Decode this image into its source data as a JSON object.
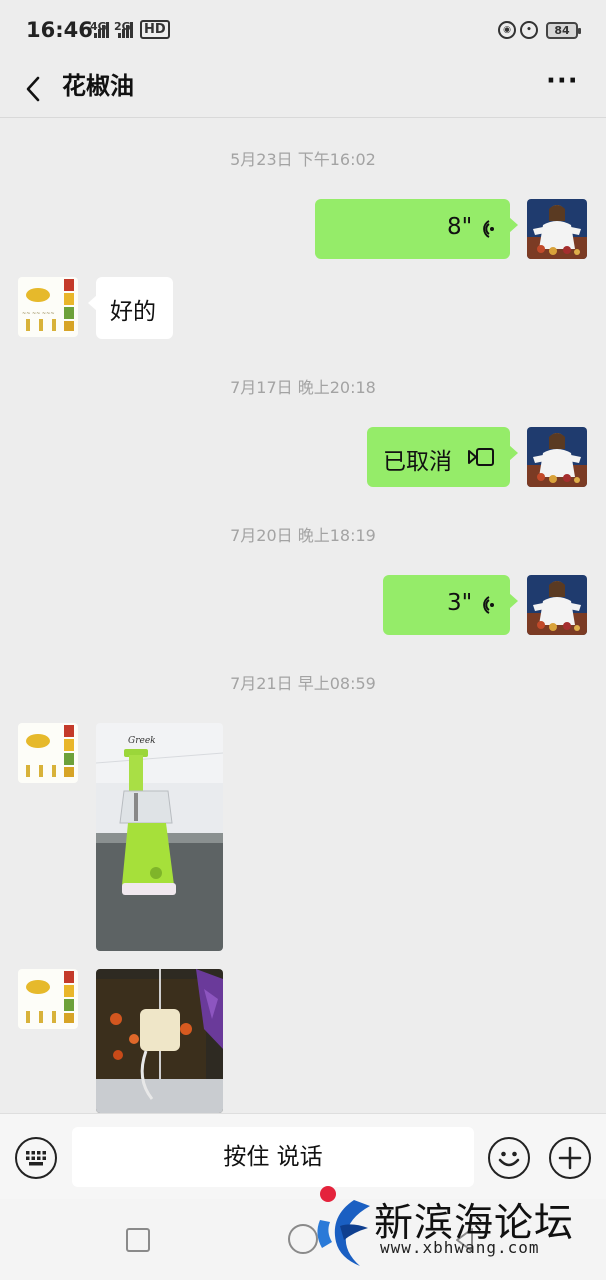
{
  "status_bar": {
    "time": "16:46",
    "net1": "4G",
    "net2": "2G",
    "hd": "HD",
    "battery": "84"
  },
  "header": {
    "title": "花椒油",
    "more": "···"
  },
  "messages": [
    {
      "kind": "timestamp",
      "text": "5月23日 下午16:02"
    },
    {
      "kind": "voice",
      "from": "me",
      "duration": "8\""
    },
    {
      "kind": "text",
      "from": "other",
      "text": "好的"
    },
    {
      "kind": "timestamp",
      "text": "7月17日 晚上20:18"
    },
    {
      "kind": "call",
      "from": "me",
      "text": "已取消"
    },
    {
      "kind": "timestamp",
      "text": "7月20日 晚上18:19"
    },
    {
      "kind": "voice",
      "from": "me",
      "duration": "3\""
    },
    {
      "kind": "timestamp",
      "text": "7月21日 早上08:59"
    },
    {
      "kind": "image",
      "from": "other",
      "caption": "Greek"
    },
    {
      "kind": "image",
      "from": "other"
    }
  ],
  "input_bar": {
    "talk_label": "按住 说话"
  },
  "watermark": {
    "name": "新滨海论坛",
    "url": "www.xbhwang.com"
  },
  "colors": {
    "my_bubble": "#95ec69",
    "other_bubble": "#ffffff",
    "background": "#ededed"
  },
  "icons": [
    "back-arrow-icon",
    "more-icon",
    "voice-wave-icon",
    "video-call-icon",
    "keyboard-icon",
    "emoji-icon",
    "plus-icon"
  ]
}
